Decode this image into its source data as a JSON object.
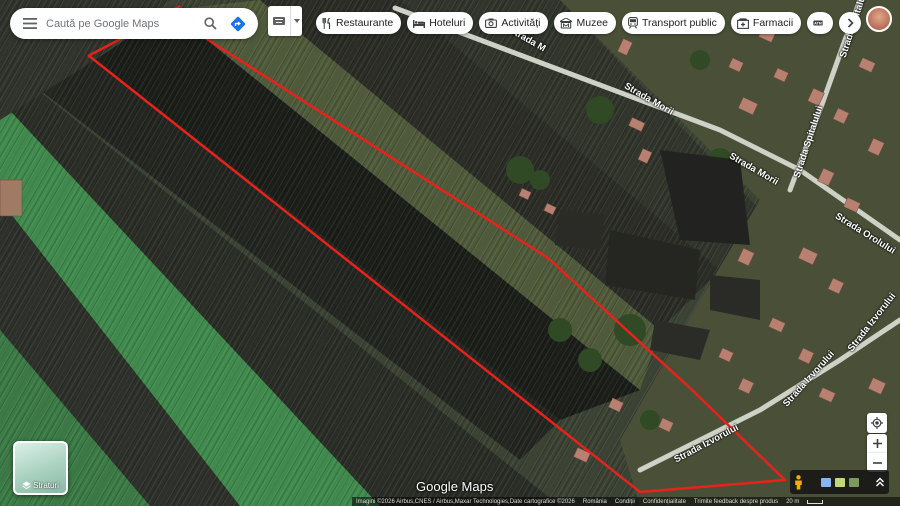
{
  "search": {
    "placeholder": "Caută pe Google Maps"
  },
  "chips": [
    {
      "label": "Restaurante",
      "icon": "fork-knife-icon"
    },
    {
      "label": "Hoteluri",
      "icon": "bed-icon"
    },
    {
      "label": "Activități",
      "icon": "camera-icon"
    },
    {
      "label": "Muzee",
      "icon": "museum-icon"
    },
    {
      "label": "Transport public",
      "icon": "train-icon"
    },
    {
      "label": "Farmacii",
      "icon": "pharmacy-icon"
    },
    {
      "label": "",
      "icon": "atm-icon"
    }
  ],
  "streets": {
    "morii_1": "Strada Morii",
    "morii_2": "Strada Morii",
    "spitalului": "Strada Spitalului",
    "spitalului_top": "Strada Spitalului",
    "orolului": "Strada Orolului",
    "izvorului_1": "Strada Izvorului",
    "izvorului_2": "Strada Izvorului",
    "izvorului_3": "Strada Izvorului",
    "m_fragment": "Strada M"
  },
  "layers": {
    "label": "Straturi"
  },
  "logo": "Google Maps",
  "footer": {
    "attribution": "Imagini ©2026 Airbus,CNES / Airbus,Maxar Technologies,Date cartografice ©2026",
    "country": "România",
    "terms": "Condiții",
    "privacy": "Confidențialitate",
    "feedback": "Trimite feedback despre produs",
    "scale": "20 m"
  },
  "colors": {
    "boundary": "#e8221b",
    "field_green": "#3f8a4c",
    "field_dark": "#1d1f1b",
    "chip_bg": "#ffffff"
  }
}
